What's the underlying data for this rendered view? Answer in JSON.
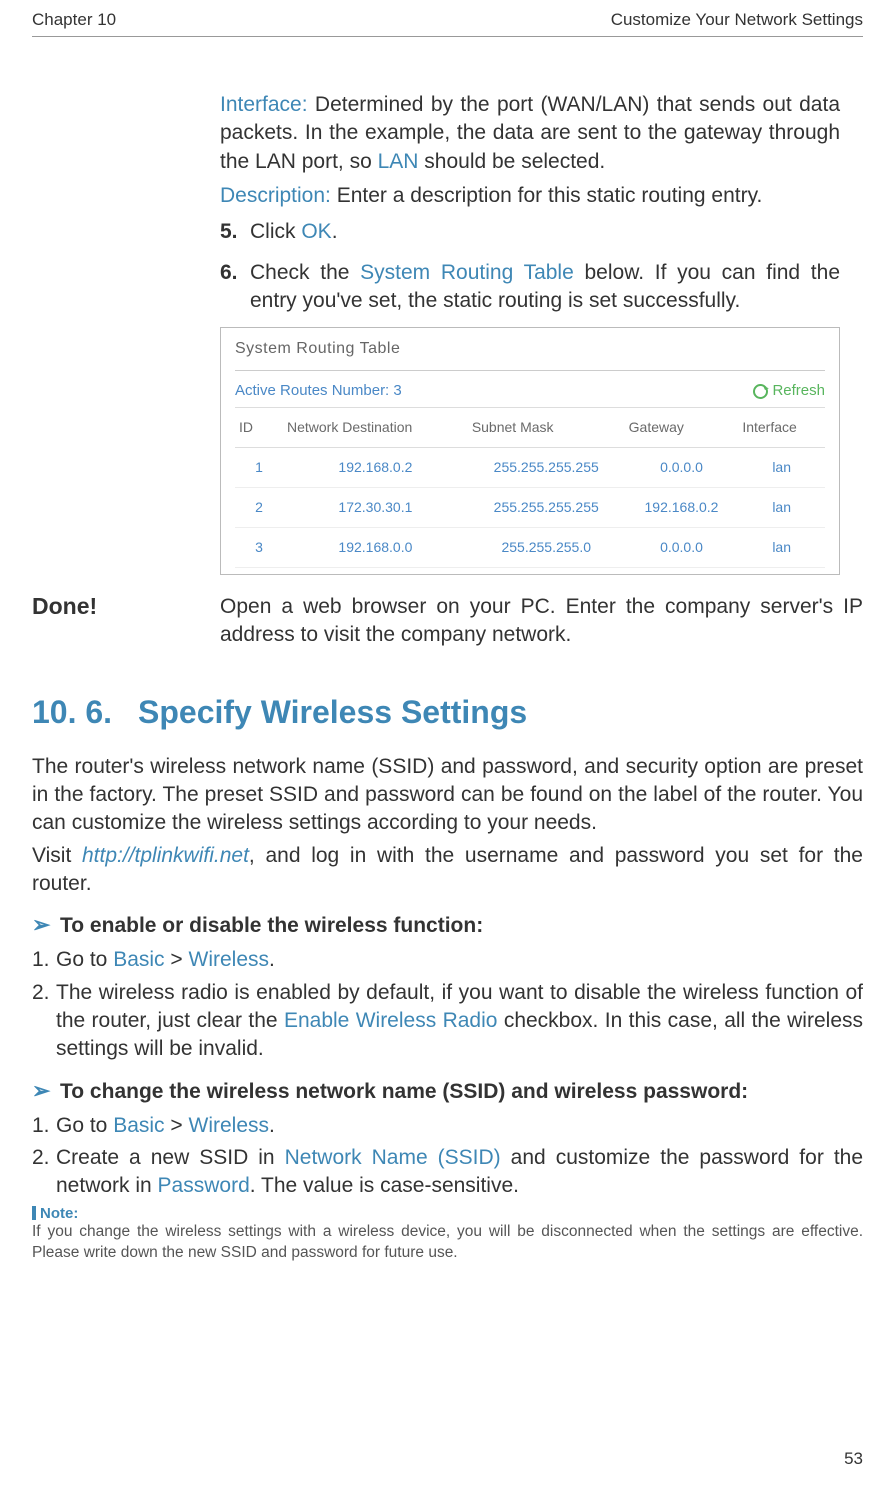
{
  "header": {
    "left": "Chapter 10",
    "right": "Customize Your Network Settings"
  },
  "interface_para": {
    "label": "Interface:",
    "text": " Determined by the port (WAN/LAN) that sends out data packets. In the example, the data are sent to the gateway through the LAN port, so ",
    "hl": "LAN",
    "tail": " should be selected."
  },
  "description_para": {
    "label": "Description:",
    "text": " Enter a description for this static routing entry."
  },
  "steps": [
    {
      "num": "5.",
      "pre": "Click ",
      "hl": "OK",
      "post": "."
    },
    {
      "num": "6.",
      "pre": "Check the ",
      "hl": "System Routing Table",
      "post": " below. If you can find the entry you've set, the static routing is set successfully."
    }
  ],
  "routing": {
    "title": "System Routing Table",
    "subtitle": "Active Routes Number: 3",
    "refresh": "Refresh",
    "headers": [
      "ID",
      "Network Destination",
      "Subnet Mask",
      "Gateway",
      "Interface"
    ],
    "rows": [
      [
        "1",
        "192.168.0.2",
        "255.255.255.255",
        "0.0.0.0",
        "lan"
      ],
      [
        "2",
        "172.30.30.1",
        "255.255.255.255",
        "192.168.0.2",
        "lan"
      ],
      [
        "3",
        "192.168.0.0",
        "255.255.255.0",
        "0.0.0.0",
        "lan"
      ]
    ]
  },
  "done": {
    "label": "Done!",
    "text": "Open a web browser on your PC. Enter the company server's IP address to visit the company network."
  },
  "section": {
    "num": "10. 6.",
    "title": "Specify Wireless Settings"
  },
  "intro": {
    "p1": "The router's wireless network name (SSID) and password, and security option are preset in the factory. The preset SSID and password can be found on the label of the router. You can customize the wireless settings according to your needs.",
    "p2_pre": "Visit ",
    "p2_link": "http://tplinkwifi.net",
    "p2_post": ", and log in with the username and password you set for the router."
  },
  "sub1": {
    "heading": "To enable or disable the wireless function:",
    "li1": {
      "n": "1.",
      "pre": "Go to ",
      "hl1": "Basic",
      "sep": " > ",
      "hl2": "Wireless",
      "post": "."
    },
    "li2": {
      "n": "2.",
      "pre": "The wireless radio is enabled by default, if you want to disable the wireless function of the router, just clear the ",
      "hl": "Enable Wireless Radio",
      "post": " checkbox. In this case, all the wireless settings will be invalid."
    }
  },
  "sub2": {
    "heading": "To change the wireless network name (SSID) and wireless password:",
    "li1": {
      "n": "1.",
      "pre": "Go to ",
      "hl1": "Basic",
      "sep": " > ",
      "hl2": "Wireless",
      "post": "."
    },
    "li2": {
      "n": "2.",
      "pre": "Create a new SSID in ",
      "hl1": "Network Name (SSID)",
      "mid": " and  customize the password for the network in ",
      "hl2": "Password",
      "post": ".  The value is case-sensitive."
    }
  },
  "note": {
    "label": "Note:",
    "body": "If you change the wireless settings with a wireless device, you will be disconnected when the settings are effective. Please write down the new SSID and password for future use."
  },
  "page_number": "53"
}
